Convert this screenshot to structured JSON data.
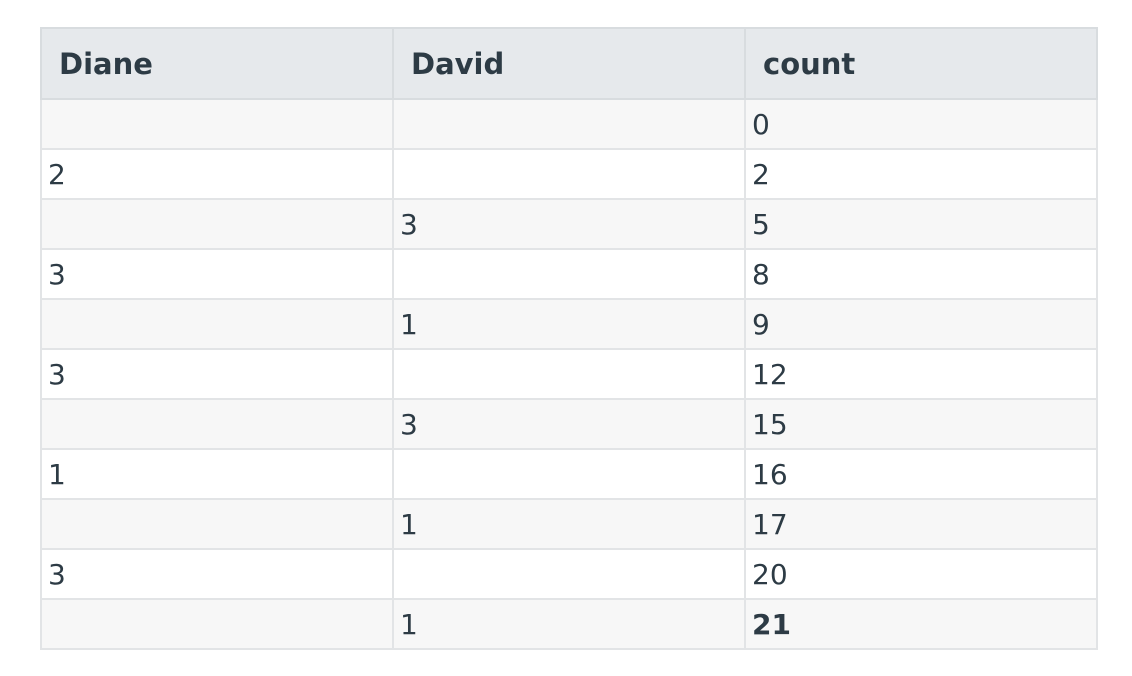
{
  "table": {
    "headers": [
      "Diane",
      "David",
      "count"
    ],
    "rows": [
      [
        "",
        "",
        "0"
      ],
      [
        "2",
        "",
        "2"
      ],
      [
        "",
        "3",
        "5"
      ],
      [
        "3",
        "",
        "8"
      ],
      [
        "",
        "1",
        "9"
      ],
      [
        "3",
        "",
        "12"
      ],
      [
        "",
        "3",
        "15"
      ],
      [
        "1",
        "",
        "16"
      ],
      [
        "",
        "1",
        "17"
      ],
      [
        "3",
        "",
        "20"
      ],
      [
        "",
        "1",
        "21"
      ]
    ]
  }
}
